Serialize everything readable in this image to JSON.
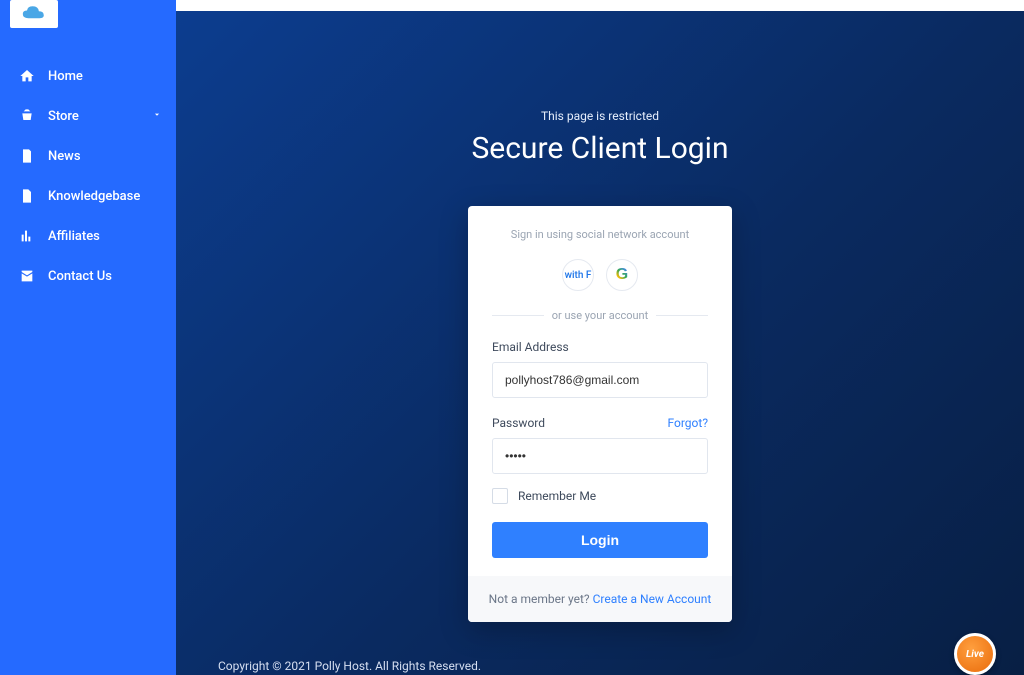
{
  "sidebar": {
    "items": [
      {
        "label": "Home"
      },
      {
        "label": "Store"
      },
      {
        "label": "News"
      },
      {
        "label": "Knowledgebase"
      },
      {
        "label": "Affiliates"
      },
      {
        "label": "Contact Us"
      }
    ]
  },
  "page": {
    "restricted_text": "This page is restricted",
    "title": "Secure Client Login"
  },
  "login": {
    "social_title": "Sign in using social network account",
    "facebook_text": "with F",
    "divider_text": "or use your account",
    "email_label": "Email Address",
    "email_value": "pollyhost786@gmail.com",
    "password_label": "Password",
    "password_value": "•••••",
    "forgot_label": "Forgot?",
    "remember_label": "Remember Me",
    "login_button": "Login",
    "not_member_text": "Not a member yet? ",
    "create_account_label": "Create a New Account"
  },
  "footer": {
    "copyright": "Copyright © 2021 Polly Host. All Rights Reserved."
  },
  "chat": {
    "label": "Live"
  }
}
